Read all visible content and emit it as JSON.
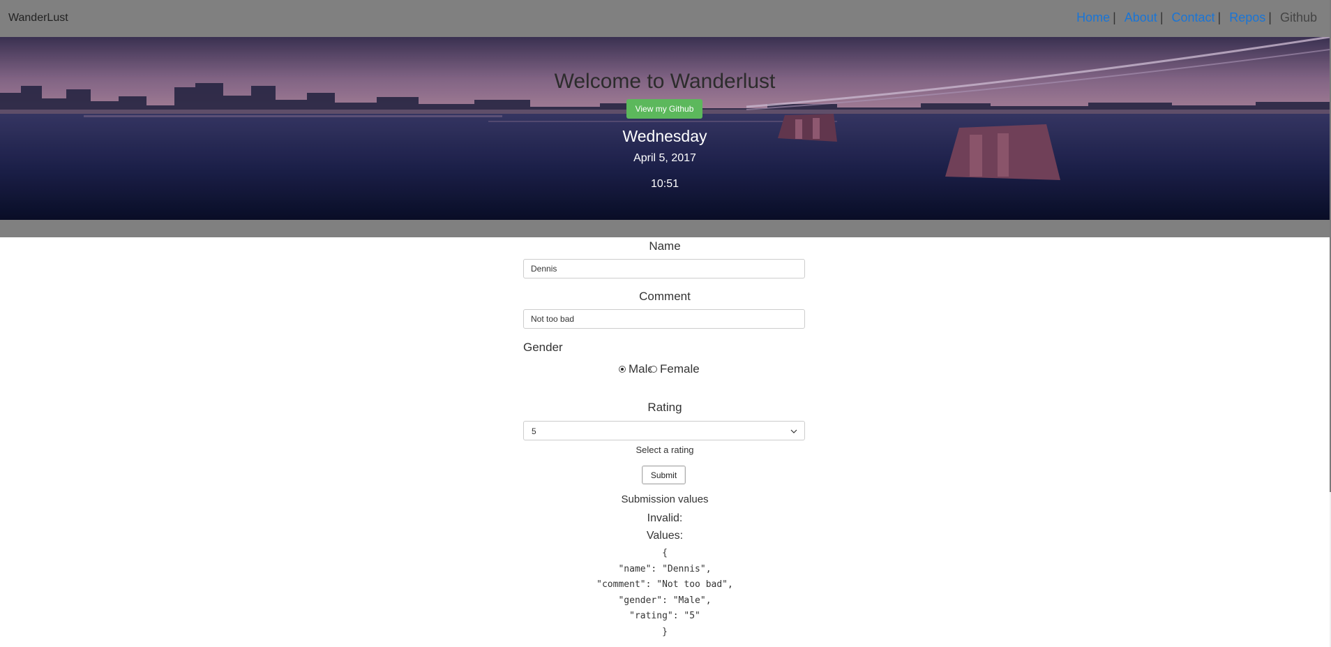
{
  "navbar": {
    "brand": "WanderLust",
    "links": [
      {
        "label": "Home",
        "active": true
      },
      {
        "label": "About",
        "active": true
      },
      {
        "label": "Contact",
        "active": true
      },
      {
        "label": "Repos",
        "active": true
      },
      {
        "label": "Github",
        "active": false
      }
    ],
    "separator": "|"
  },
  "hero": {
    "title": "Welcome to Wanderlust",
    "button_label": "View my Github",
    "day": "Wednesday",
    "date": "April 5, 2017",
    "time": "10:51"
  },
  "form": {
    "name_label": "Name",
    "name_value": "Dennis",
    "comment_label": "Comment",
    "comment_value": "Not too bad",
    "gender_label": "Gender",
    "gender_options": [
      {
        "label": "Male",
        "checked": true
      },
      {
        "label": "Female",
        "checked": false
      }
    ],
    "rating_label": "Rating",
    "rating_value": "5",
    "rating_help": "Select a rating",
    "submit_label": "Submit"
  },
  "submission": {
    "heading": "Submission values",
    "invalid_label": "Invalid:",
    "values_label": "Values:",
    "json_lines": [
      "{",
      "\"name\": \"Dennis\",",
      "\"comment\": \"Not too bad\",",
      "\"gender\": \"Male\",",
      "\"rating\": \"5\"",
      "}"
    ]
  },
  "colors": {
    "navbar_bg": "#808080",
    "link": "#1a75d6",
    "success_button": "#5cb85c"
  }
}
